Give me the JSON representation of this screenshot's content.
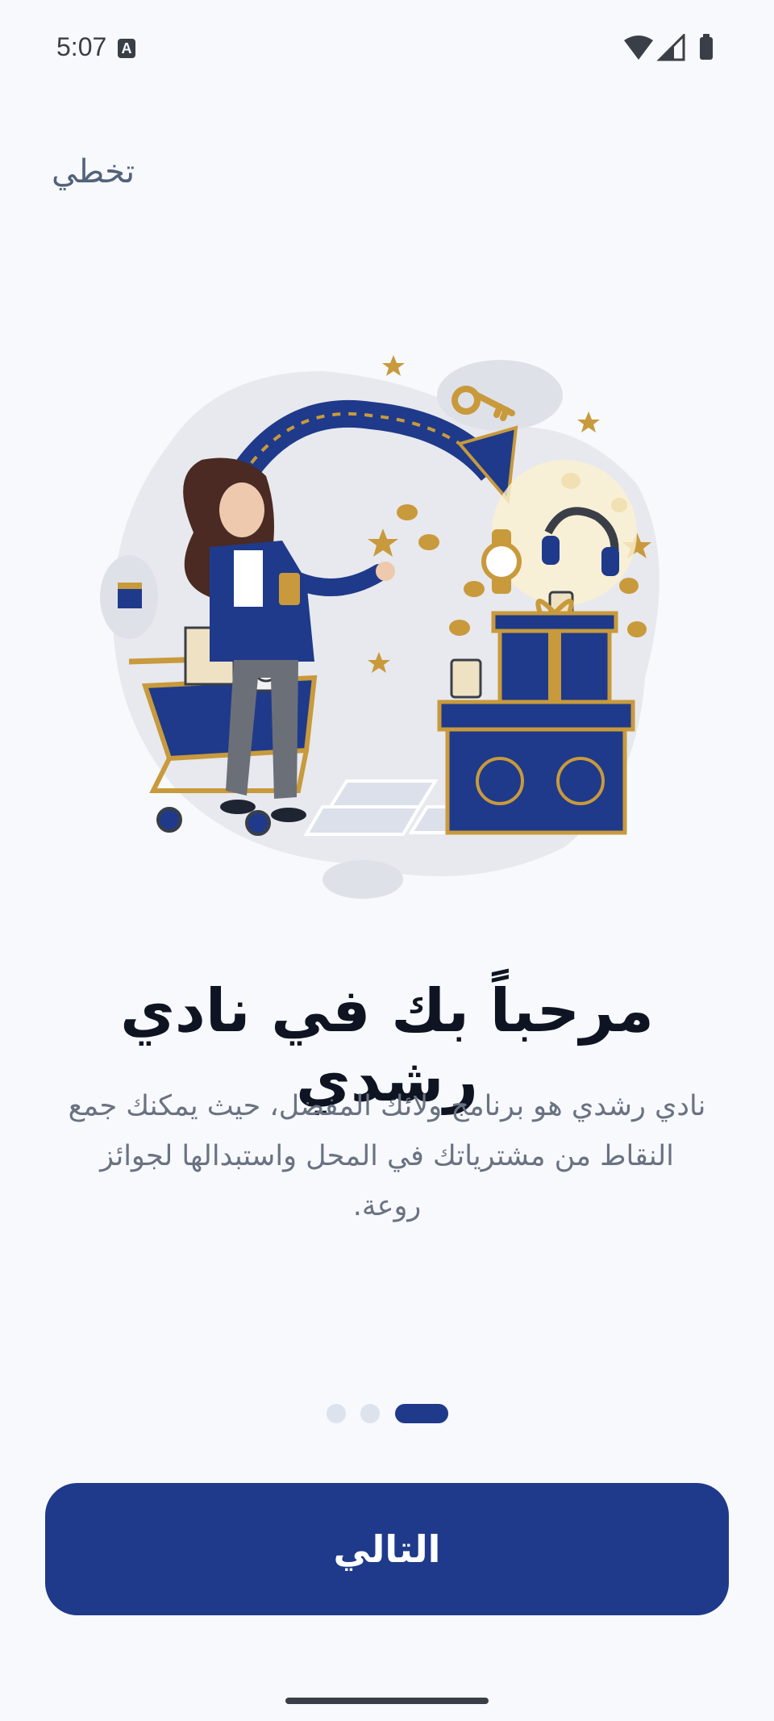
{
  "status_bar": {
    "time": "5:07",
    "badge": "A",
    "icons": [
      "wifi-icon",
      "signal-icon",
      "battery-icon"
    ]
  },
  "onboarding": {
    "skip_label": "تخطي",
    "title": "مرحباً بك في نادي رشدي",
    "description": "نادي رشدي هو برنامج ولائك المفضل، حيث يمكنك جمع النقاط من مشترياتك في المحل واستبدالها لجوائز روعة.",
    "page_indicator": {
      "total": 3,
      "active": 3
    },
    "next_label": "التالي"
  },
  "colors": {
    "primary": "#1f3a8a",
    "gold": "#c89a3c",
    "background": "#f7f9fc"
  }
}
